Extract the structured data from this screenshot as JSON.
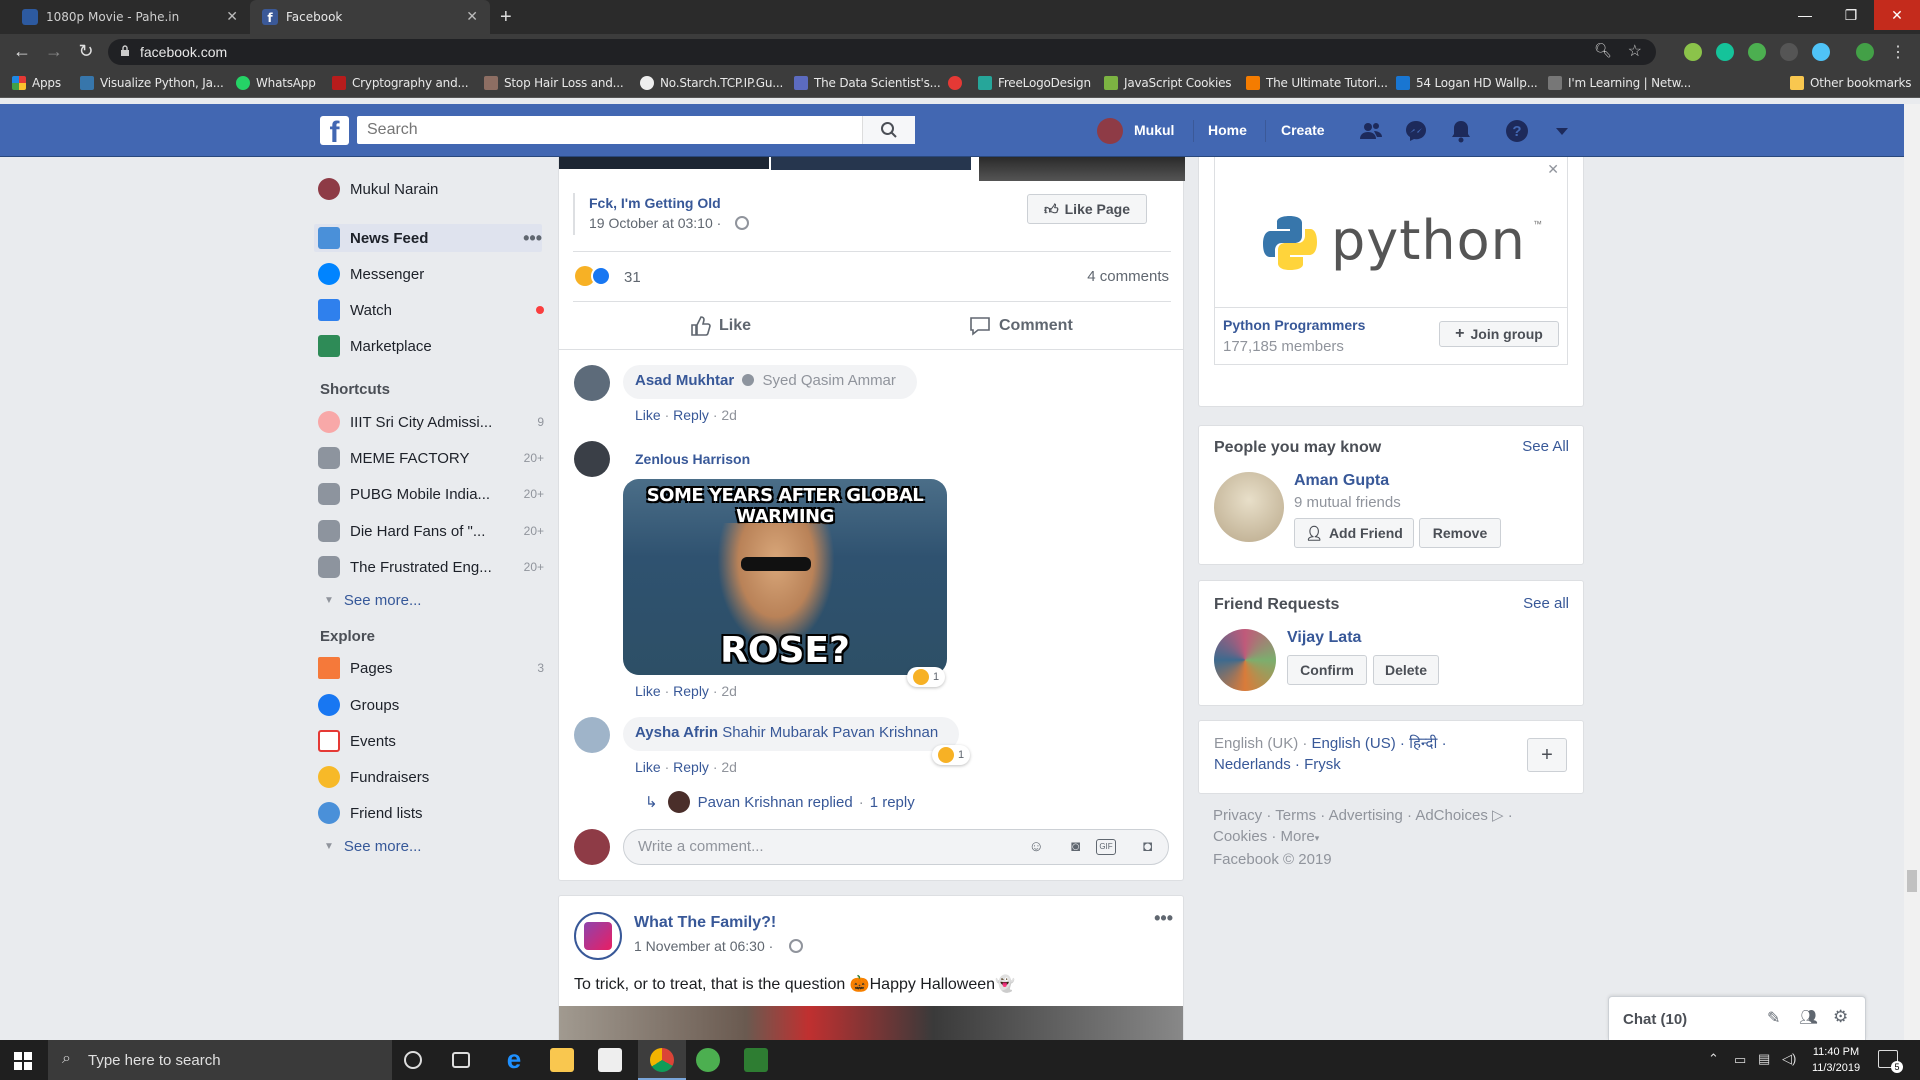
{
  "browser": {
    "tabs": [
      {
        "title": "1080p Movie - Pahe.in",
        "active": false
      },
      {
        "title": "Facebook",
        "active": true
      }
    ],
    "url": "facebook.com",
    "bookmarks": [
      "Apps",
      "Visualize Python, Ja...",
      "WhatsApp",
      "Cryptography and...",
      "Stop Hair Loss and...",
      "No.Starch.TCP.IP.Gu...",
      "The Data Scientist's...",
      "",
      "FreeLogoDesign",
      "JavaScript Cookies",
      "The Ultimate Tutori...",
      "54 Logan HD Wallp...",
      "I'm Learning | Netw..."
    ],
    "other_bookmarks": "Other bookmarks"
  },
  "fb_header": {
    "search_placeholder": "Search",
    "user": "Mukul",
    "home": "Home",
    "create": "Create"
  },
  "left_nav": {
    "profile_name": "Mukul Narain",
    "main": [
      {
        "label": "News Feed",
        "icon": "news-feed-icon",
        "active": true
      },
      {
        "label": "Messenger",
        "icon": "messenger-icon"
      },
      {
        "label": "Watch",
        "icon": "watch-icon"
      },
      {
        "label": "Marketplace",
        "icon": "marketplace-icon"
      }
    ],
    "shortcuts_title": "Shortcuts",
    "shortcuts": [
      {
        "label": "IIIT Sri City Admissi...",
        "count": "9"
      },
      {
        "label": "MEME FACTORY",
        "count": "20+"
      },
      {
        "label": "PUBG Mobile India...",
        "count": "20+"
      },
      {
        "label": "Die Hard Fans of \"...",
        "count": "20+"
      },
      {
        "label": "The Frustrated Eng...",
        "count": "20+"
      }
    ],
    "see_more": "See more...",
    "explore_title": "Explore",
    "explore": [
      {
        "label": "Pages",
        "count": "3"
      },
      {
        "label": "Groups",
        "count": ""
      },
      {
        "label": "Events",
        "count": ""
      },
      {
        "label": "Fundraisers",
        "count": ""
      },
      {
        "label": "Friend lists",
        "count": ""
      }
    ]
  },
  "post1": {
    "shared_page": "Fck, I'm Getting Old",
    "shared_date": "19 October at 03:10 ·",
    "like_page": "Like Page",
    "reaction_count": "31",
    "comments_count": "4 comments",
    "like_label": "Like",
    "comment_label": "Comment",
    "comments": [
      {
        "author": "Asad Mukhtar",
        "text": "Syed Qasim Ammar",
        "actions": [
          "Like",
          "Reply"
        ],
        "time": "2d"
      },
      {
        "author": "Zenlous Harrison",
        "meme_top": "SOME YEARS AFTER GLOBAL WARMING",
        "meme_bottom": "ROSE?",
        "reaction": "1",
        "actions": [
          "Like",
          "Reply"
        ],
        "time": "2d"
      },
      {
        "author": "Aysha Afrin",
        "text": "Shahir Mubarak Pavan Krishnan",
        "reaction": "1",
        "actions": [
          "Like",
          "Reply"
        ],
        "time": "2d"
      }
    ],
    "reply_by": "Pavan Krishnan replied",
    "reply_count": "1 reply",
    "write_comment": "Write a comment..."
  },
  "post2": {
    "page": "What The Family?!",
    "date": "1 November at 06:30 ·",
    "text": "To trick, or to treat, that is the question 🎃Happy Halloween👻"
  },
  "right": {
    "group": {
      "name": "Python Programmers",
      "members": "177,185 members",
      "join": "Join group",
      "logo_text": "python"
    },
    "people": {
      "title": "People you may know",
      "see_all": "See All",
      "name": "Aman Gupta",
      "mutual": "9 mutual friends",
      "add": "Add Friend",
      "remove": "Remove"
    },
    "requests": {
      "title": "Friend Requests",
      "see_all": "See all",
      "name": "Vijay Lata",
      "confirm": "Confirm",
      "delete": "Delete"
    },
    "languages": [
      "English (UK) ·",
      "English (US) ·",
      "हिन्दी ·",
      "Nederlands ·",
      "Frysk"
    ],
    "footer_links": [
      "Privacy ·",
      "Terms ·",
      "Advertising ·",
      "AdChoices",
      "Cookies ·",
      "More"
    ],
    "copyright": "Facebook © 2019"
  },
  "chat": {
    "label": "Chat (10)"
  },
  "taskbar": {
    "search": "Type here to search",
    "time": "11:40 PM",
    "date": "11/3/2019",
    "notif": "5"
  },
  "colors": {
    "fb_blue": "#4267b2",
    "link": "#385898"
  }
}
